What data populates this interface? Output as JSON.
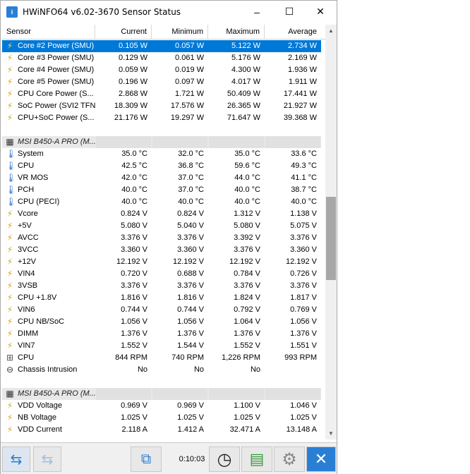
{
  "window": {
    "title": "HWiNFO64 v6.02-3670 Sensor Status",
    "app_icon": "hwinfo-icon",
    "controls": {
      "minimize": "–",
      "maximize": "☐",
      "close": "✕"
    }
  },
  "table": {
    "columns": {
      "sensor": "Sensor",
      "current": "Current",
      "minimum": "Minimum",
      "maximum": "Maximum",
      "average": "Average"
    },
    "rows": [
      {
        "type": "data",
        "icon": "power-icon",
        "name": "Core #2 Power (SMU)",
        "current": "0.105 W",
        "min": "0.057 W",
        "max": "5.122 W",
        "avg": "2.734 W",
        "selected": true
      },
      {
        "type": "data",
        "icon": "power-icon",
        "name": "Core #3 Power (SMU)",
        "current": "0.129 W",
        "min": "0.061 W",
        "max": "5.176 W",
        "avg": "2.169 W"
      },
      {
        "type": "data",
        "icon": "power-icon",
        "name": "Core #4 Power (SMU)",
        "current": "0.059 W",
        "min": "0.019 W",
        "max": "4.300 W",
        "avg": "1.936 W"
      },
      {
        "type": "data",
        "icon": "power-icon",
        "name": "Core #5 Power (SMU)",
        "current": "0.196 W",
        "min": "0.097 W",
        "max": "4.017 W",
        "avg": "1.911 W"
      },
      {
        "type": "data",
        "icon": "power-icon",
        "name": "CPU Core Power (S...",
        "current": "2.868 W",
        "min": "1.721 W",
        "max": "50.409 W",
        "avg": "17.441 W"
      },
      {
        "type": "data",
        "icon": "power-icon",
        "name": "SoC Power (SVI2 TFN)",
        "current": "18.309 W",
        "min": "17.576 W",
        "max": "26.365 W",
        "avg": "21.927 W"
      },
      {
        "type": "data",
        "icon": "power-icon",
        "name": "CPU+SoC Power (S...",
        "current": "21.176 W",
        "min": "19.297 W",
        "max": "71.647 W",
        "avg": "39.368 W"
      },
      {
        "type": "blank"
      },
      {
        "type": "group",
        "icon": "chip-icon",
        "name": "MSI B450-A PRO (M..."
      },
      {
        "type": "data",
        "icon": "temperature-icon",
        "name": "System",
        "current": "35.0 °C",
        "min": "32.0 °C",
        "max": "35.0 °C",
        "avg": "33.6 °C"
      },
      {
        "type": "data",
        "icon": "temperature-icon",
        "name": "CPU",
        "current": "42.5 °C",
        "min": "36.8 °C",
        "max": "59.6 °C",
        "avg": "49.3 °C"
      },
      {
        "type": "data",
        "icon": "temperature-icon",
        "name": "VR MOS",
        "current": "42.0 °C",
        "min": "37.0 °C",
        "max": "44.0 °C",
        "avg": "41.1 °C"
      },
      {
        "type": "data",
        "icon": "temperature-icon",
        "name": "PCH",
        "current": "40.0 °C",
        "min": "37.0 °C",
        "max": "40.0 °C",
        "avg": "38.7 °C"
      },
      {
        "type": "data",
        "icon": "temperature-icon",
        "name": "CPU (PECI)",
        "current": "40.0 °C",
        "min": "40.0 °C",
        "max": "40.0 °C",
        "avg": "40.0 °C"
      },
      {
        "type": "data",
        "icon": "power-icon",
        "name": "Vcore",
        "current": "0.824 V",
        "min": "0.824 V",
        "max": "1.312 V",
        "avg": "1.138 V"
      },
      {
        "type": "data",
        "icon": "power-icon",
        "name": "+5V",
        "current": "5.080 V",
        "min": "5.040 V",
        "max": "5.080 V",
        "avg": "5.075 V"
      },
      {
        "type": "data",
        "icon": "power-icon",
        "name": "AVCC",
        "current": "3.376 V",
        "min": "3.376 V",
        "max": "3.392 V",
        "avg": "3.376 V"
      },
      {
        "type": "data",
        "icon": "power-icon",
        "name": "3VCC",
        "current": "3.360 V",
        "min": "3.360 V",
        "max": "3.376 V",
        "avg": "3.360 V"
      },
      {
        "type": "data",
        "icon": "power-icon",
        "name": "+12V",
        "current": "12.192 V",
        "min": "12.192 V",
        "max": "12.192 V",
        "avg": "12.192 V"
      },
      {
        "type": "data",
        "icon": "power-icon",
        "name": "VIN4",
        "current": "0.720 V",
        "min": "0.688 V",
        "max": "0.784 V",
        "avg": "0.726 V"
      },
      {
        "type": "data",
        "icon": "power-icon",
        "name": "3VSB",
        "current": "3.376 V",
        "min": "3.376 V",
        "max": "3.376 V",
        "avg": "3.376 V"
      },
      {
        "type": "data",
        "icon": "power-icon",
        "name": "CPU +1.8V",
        "current": "1.816 V",
        "min": "1.816 V",
        "max": "1.824 V",
        "avg": "1.817 V"
      },
      {
        "type": "data",
        "icon": "power-icon",
        "name": "VIN6",
        "current": "0.744 V",
        "min": "0.744 V",
        "max": "0.792 V",
        "avg": "0.769 V"
      },
      {
        "type": "data",
        "icon": "power-icon",
        "name": "CPU NB/SoC",
        "current": "1.056 V",
        "min": "1.056 V",
        "max": "1.064 V",
        "avg": "1.056 V"
      },
      {
        "type": "data",
        "icon": "power-icon",
        "name": "DIMM",
        "current": "1.376 V",
        "min": "1.376 V",
        "max": "1.376 V",
        "avg": "1.376 V"
      },
      {
        "type": "data",
        "icon": "power-icon",
        "name": "VIN7",
        "current": "1.552 V",
        "min": "1.544 V",
        "max": "1.552 V",
        "avg": "1.551 V"
      },
      {
        "type": "data",
        "icon": "fan-icon",
        "name": "CPU",
        "current": "844 RPM",
        "min": "740 RPM",
        "max": "1,226 RPM",
        "avg": "993 RPM"
      },
      {
        "type": "data",
        "icon": "intrusion-icon",
        "name": "Chassis Intrusion",
        "current": "No",
        "min": "No",
        "max": "No",
        "avg": ""
      },
      {
        "type": "blank"
      },
      {
        "type": "group",
        "icon": "chip-icon",
        "name": "MSI B450-A PRO (M..."
      },
      {
        "type": "data",
        "icon": "power-icon",
        "name": "VDD Voltage",
        "current": "0.969 V",
        "min": "0.969 V",
        "max": "1.100 V",
        "avg": "1.046 V"
      },
      {
        "type": "data",
        "icon": "power-icon",
        "name": "NB Voltage",
        "current": "1.025 V",
        "min": "1.025 V",
        "max": "1.025 V",
        "avg": "1.025 V"
      },
      {
        "type": "data",
        "icon": "power-icon",
        "name": "VDD Current",
        "current": "2.118 A",
        "min": "1.412 A",
        "max": "32.471 A",
        "avg": "13.148 A"
      }
    ]
  },
  "toolbar": {
    "timer": "0:10:03",
    "buttons": {
      "back": "back-arrows-icon",
      "forward": "forward-arrows-icon",
      "network": "network-icon",
      "clock": "clock-icon",
      "report": "report-icon",
      "settings": "gear-icon",
      "exit": "close-icon"
    }
  }
}
